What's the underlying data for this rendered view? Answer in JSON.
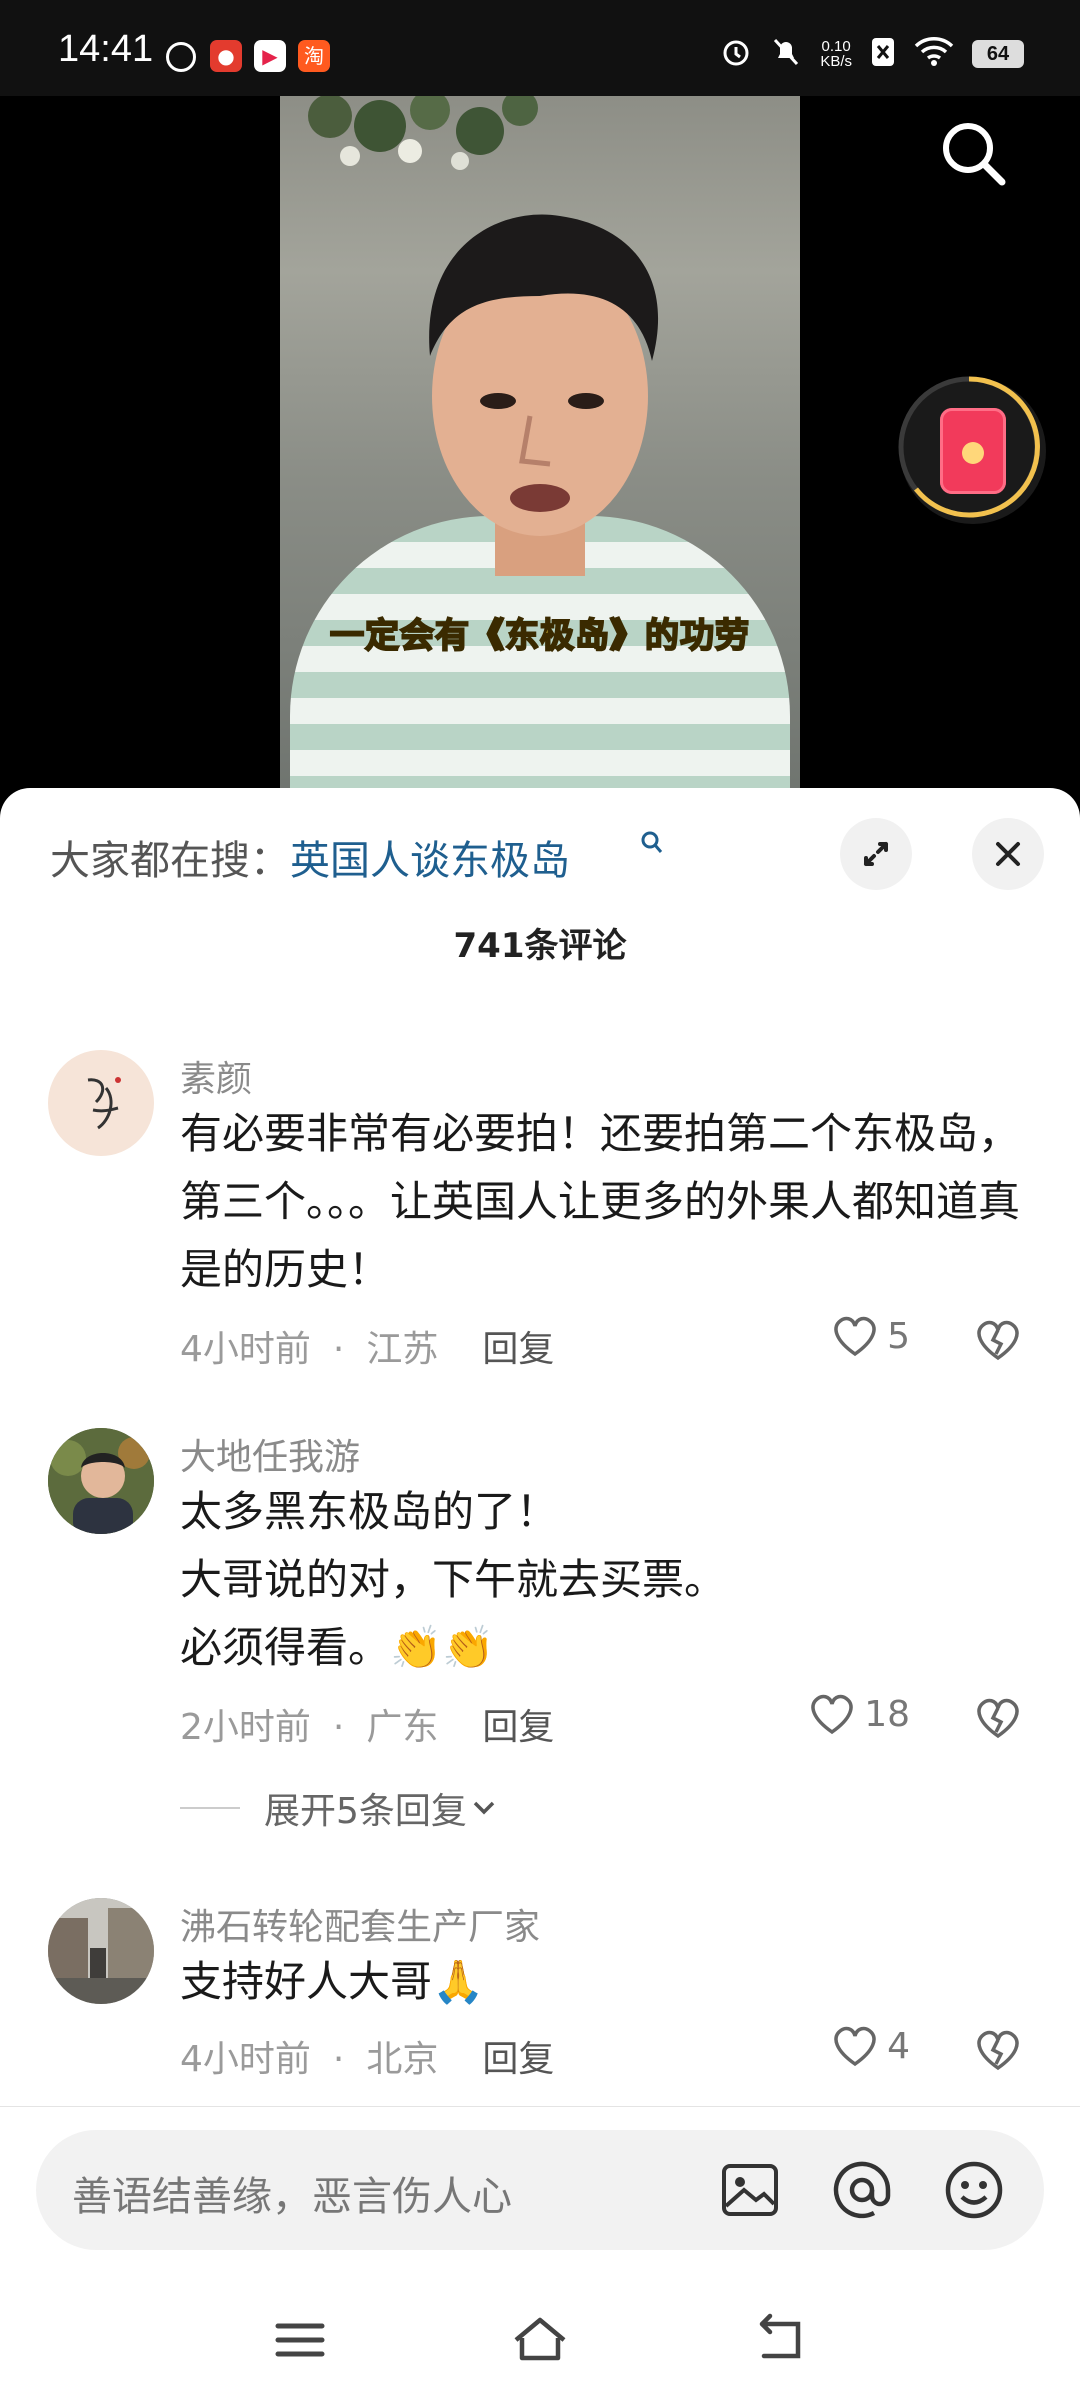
{
  "status_bar": {
    "time": "14:41",
    "app_icons": [
      "weibo-icon",
      "app-red-icon",
      "video-app-icon",
      "taobao-icon"
    ],
    "taobao_label": "淘",
    "net_speed_top": "0.10",
    "net_speed_bottom": "KB/s",
    "battery": "64"
  },
  "video": {
    "subtitle": "一定会有《东极岛》的功劳"
  },
  "search_banner": {
    "prefix": "大家都在搜：",
    "query": "英国人谈东极岛"
  },
  "comment_count": "741条评论",
  "comments": [
    {
      "user": "素颜",
      "text": "有必要非常有必要拍！还要拍第二个东极岛，第三个。。。让英国人让更多的外果人都知道真是的历史！",
      "time": "4小时前",
      "location": "江苏",
      "reply": "回复",
      "likes": "5"
    },
    {
      "user": "大地任我游",
      "text": "太多黑东极岛的了！\n大哥说的对，下午就去买票。\n必须得看。👏👏",
      "time": "2小时前",
      "location": "广东",
      "reply": "回复",
      "likes": "18",
      "expand": "展开5条回复"
    },
    {
      "user": "沸石转轮配套生产厂家",
      "text": "支持好人大哥🙏",
      "time": "4小时前",
      "location": "北京",
      "reply": "回复",
      "likes": "4"
    }
  ],
  "input": {
    "placeholder": "善语结善缘，恶言伤人心"
  },
  "colors": {
    "search_link": "#1f5f8f",
    "subtitle": "#f8d93a",
    "red_packet": "#f23a5b"
  }
}
